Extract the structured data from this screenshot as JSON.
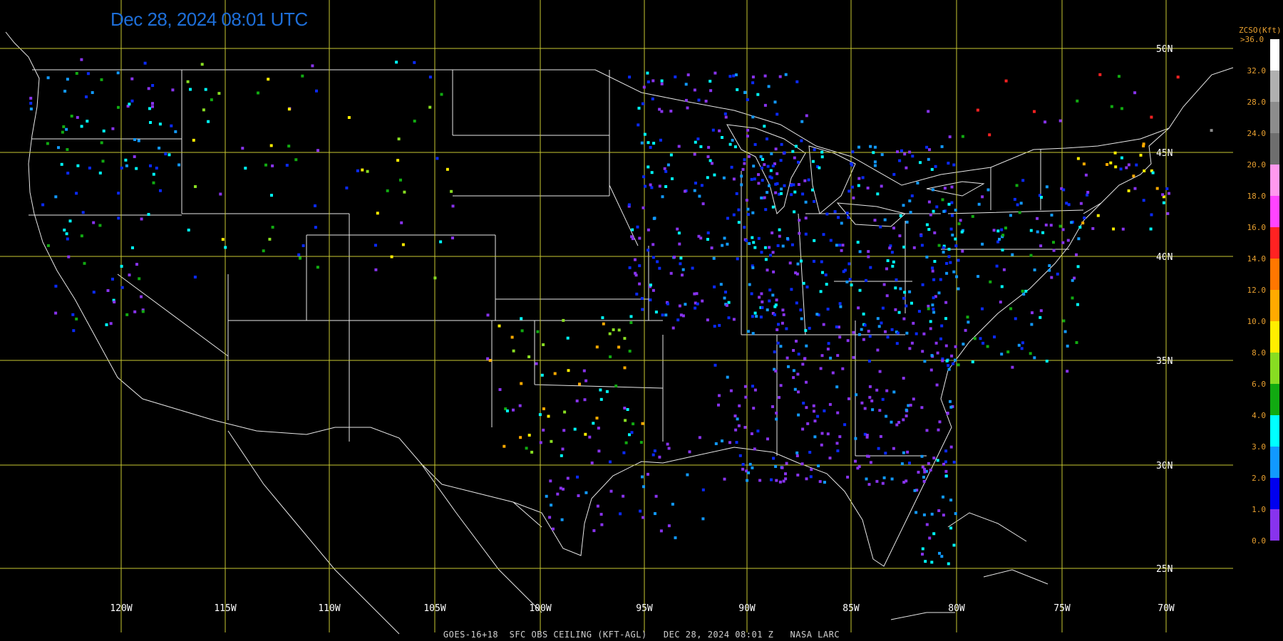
{
  "title": "Dec 28, 2024 08:01 UTC",
  "footer": "GOES-16+18  SFC OBS CEILING (KFT-AGL)   DEC 28, 2024 08:01 Z   NASA LARC",
  "legend": {
    "title": "ZCSO(Kft)",
    "top_label": ">36.0",
    "labels": [
      "32.0",
      "28.0",
      "24.0",
      "20.0",
      "18.0",
      "16.0",
      "14.0",
      "12.0",
      "10.0",
      "8.0",
      "6.0",
      "4.0",
      "3.0",
      "2.0",
      "1.0",
      "0.0"
    ],
    "colors": [
      "#ffffff",
      "#b0b0b0",
      "#8c8c8c",
      "#6e6e6e",
      "#ff99ee",
      "#ff44ff",
      "#ff2222",
      "#ff7700",
      "#ffaa00",
      "#ffee00",
      "#88dd22",
      "#11aa11",
      "#00ffff",
      "#1199ff",
      "#0000ee",
      "#8833ee"
    ]
  },
  "grid": {
    "latitudes": [
      "50N",
      "45N",
      "40N",
      "35N",
      "30N",
      "25N"
    ],
    "longitudes": [
      "120W",
      "115W",
      "110W",
      "105W",
      "100W",
      "95W",
      "90W",
      "85W",
      "80W",
      "75W",
      "70W"
    ],
    "line_color": "#c8c832",
    "label_color": "#ffffff"
  },
  "station_colors": {
    "violet": "#8833ee",
    "blue": "#0a2aff",
    "lightblue": "#1199ff",
    "cyan": "#00ffff",
    "green": "#11aa11",
    "lime": "#88dd22",
    "yellow": "#ffee00",
    "orange": "#ffaa00",
    "red": "#ff2222",
    "gray": "#8c8c8c"
  }
}
